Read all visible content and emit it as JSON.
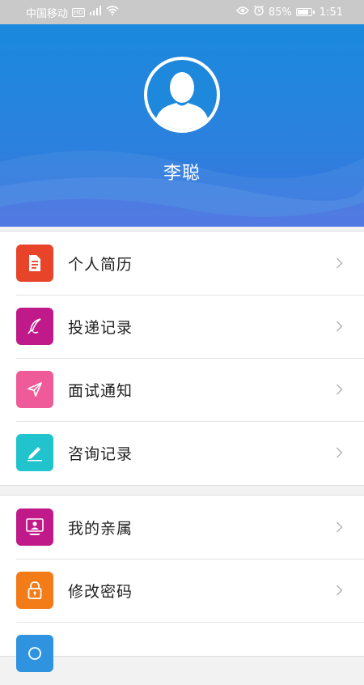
{
  "status_bar": {
    "carrier": "中国移动",
    "hd": "HD",
    "signal": "4G",
    "battery_percent": "85%",
    "battery_level": 0.85,
    "time": "1:51",
    "icons": [
      "signal-icon",
      "wifi-icon",
      "eye-icon",
      "alarm-icon",
      "battery-icon"
    ]
  },
  "profile": {
    "name": "李聪"
  },
  "colors": {
    "header": "#1f86dc",
    "resume": "#e8442a",
    "delivery": "#c01a8a",
    "interview": "#ef5b98",
    "consult": "#21c3cc",
    "relatives": "#c01a8a",
    "password": "#f47c18",
    "more": "#2f93e0"
  },
  "menu": {
    "group1": [
      {
        "label": "个人简历",
        "icon": "resume-document-icon",
        "color": "#e8442a"
      },
      {
        "label": "投递记录",
        "icon": "quill-pen-icon",
        "color": "#c01a8a"
      },
      {
        "label": "面试通知",
        "icon": "paper-plane-icon",
        "color": "#ef5b98"
      },
      {
        "label": "咨询记录",
        "icon": "pencil-icon",
        "color": "#21c3cc"
      }
    ],
    "group2": [
      {
        "label": "我的亲属",
        "icon": "family-icon",
        "color": "#c01a8a"
      },
      {
        "label": "修改密码",
        "icon": "lock-icon",
        "color": "#f47c18"
      },
      {
        "label": "",
        "icon": "more-icon",
        "color": "#2f93e0"
      }
    ]
  }
}
